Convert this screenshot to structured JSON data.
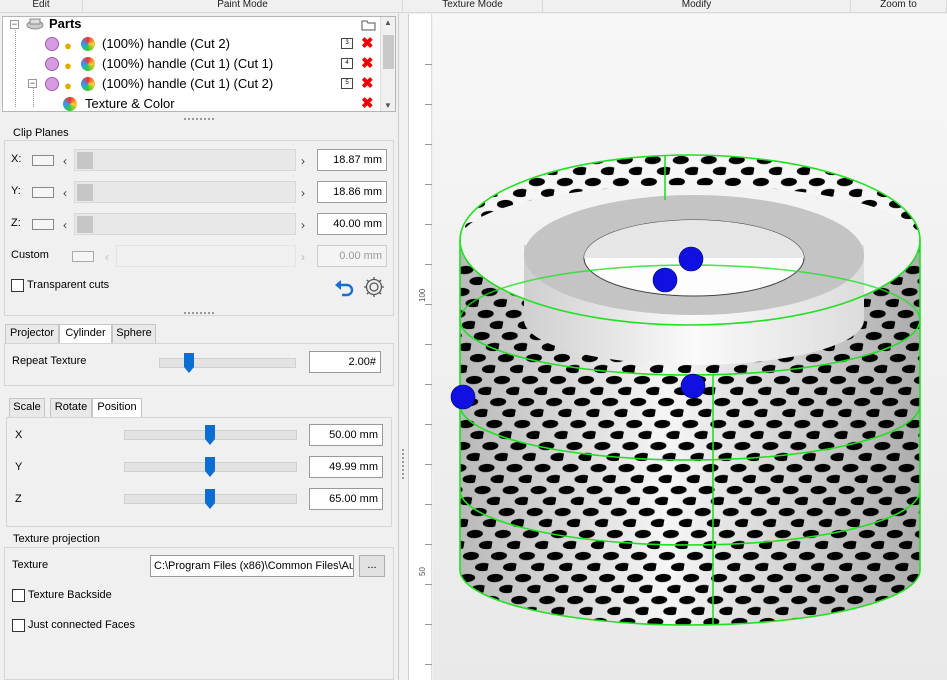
{
  "menubar": {
    "items": [
      "Edit",
      "Paint Mode",
      "Texture Mode",
      "Modify",
      "Zoom to"
    ]
  },
  "tree": {
    "root_label": "Parts",
    "items": [
      {
        "label": "(100%) handle (Cut 2)",
        "badge": "3"
      },
      {
        "label": "(100%) handle (Cut 1) (Cut 1)",
        "badge": "4"
      },
      {
        "label": "(100%) handle (Cut 1) (Cut 2)",
        "badge": "5"
      },
      {
        "label": "Texture & Color",
        "badge": ""
      }
    ]
  },
  "clip_planes": {
    "title": "Clip Planes",
    "x_label": "X:",
    "x_value": "18.87 mm",
    "y_label": "Y:",
    "y_value": "18.86 mm",
    "z_label": "Z:",
    "z_value": "40.00 mm",
    "custom_label": "Custom",
    "custom_value": "0.00 mm",
    "transparent_cuts": "Transparent cuts"
  },
  "projection_tabs": [
    "Projector",
    "Cylinder",
    "Sphere"
  ],
  "projection_active": "Cylinder",
  "repeat_texture": {
    "label": "Repeat Texture",
    "value": "2.00#"
  },
  "transform_tabs": [
    "Scale",
    "Rotate",
    "Position"
  ],
  "transform_active": "Position",
  "position": {
    "x_label": "X",
    "x_value": "50.00 mm",
    "y_label": "Y",
    "y_value": "49.99 mm",
    "z_label": "Z",
    "z_value": "65.00 mm"
  },
  "texture_projection": {
    "title": "Texture projection",
    "texture_label": "Texture",
    "texture_path": "C:\\Program Files (x86)\\Common Files\\Aut",
    "browse": "...",
    "backside": "Texture Backside",
    "connected": "Just connected Faces"
  },
  "ruler": {
    "labels": [
      "100",
      "50"
    ]
  },
  "colors": {
    "accent": "#0a6fd0",
    "wire": "#22e022",
    "marker": "#1010e0",
    "delete": "#e00000"
  }
}
